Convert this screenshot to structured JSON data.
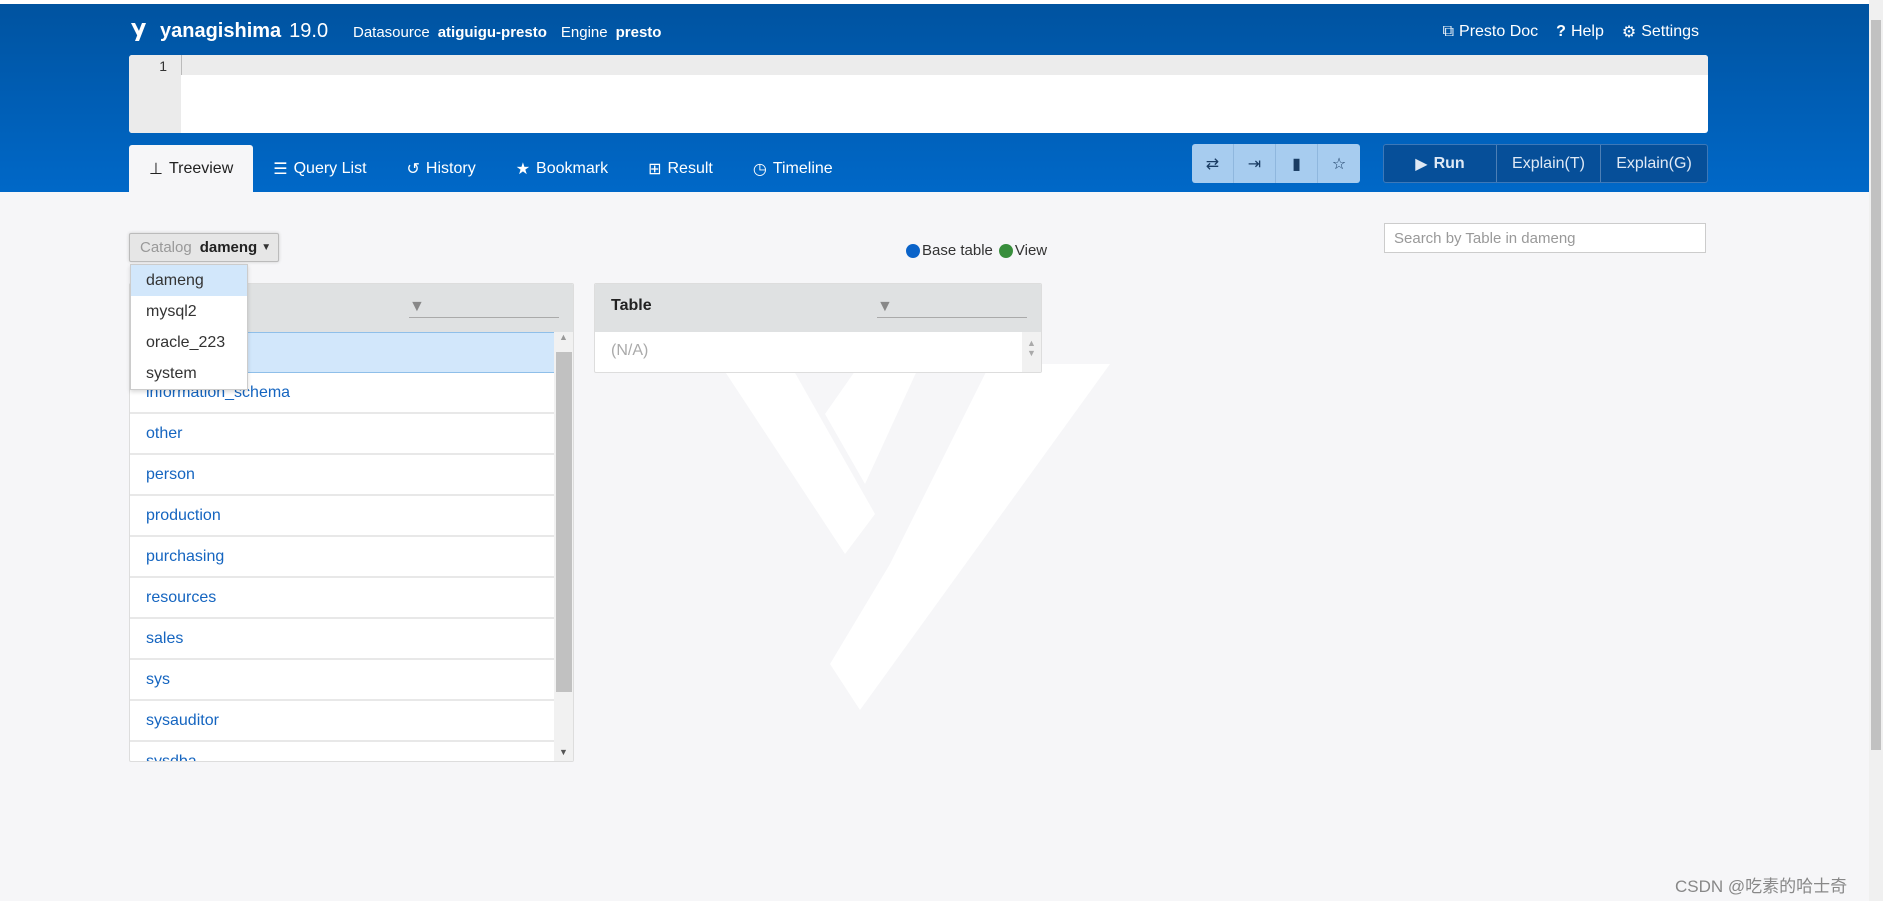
{
  "header": {
    "app_name": "yanagishima",
    "version": "19.0",
    "datasource_label": "Datasource",
    "datasource": "atiguigu-presto",
    "engine_label": "Engine",
    "engine": "presto",
    "links": [
      {
        "label": "Presto Doc",
        "icon": "external-link-icon"
      },
      {
        "label": "Help",
        "icon": "question-icon"
      },
      {
        "label": "Settings",
        "icon": "gear-icon"
      }
    ]
  },
  "editor": {
    "line_number": "1",
    "content": ""
  },
  "tabs": [
    {
      "label": "Treeview",
      "icon": "sitemap-icon",
      "active": true
    },
    {
      "label": "Query List",
      "icon": "list-icon"
    },
    {
      "label": "History",
      "icon": "history-icon"
    },
    {
      "label": "Bookmark",
      "icon": "star-icon"
    },
    {
      "label": "Result",
      "icon": "table-icon"
    },
    {
      "label": "Timeline",
      "icon": "clock-icon"
    }
  ],
  "tools": [
    "swap-icon",
    "indent-icon",
    "clipboard-icon",
    "star-outline-icon"
  ],
  "actions": {
    "run": "Run",
    "explain_t": "Explain(T)",
    "explain_g": "Explain(G)"
  },
  "catalog": {
    "label": "Catalog",
    "value": "dameng",
    "options": [
      "dameng",
      "mysql2",
      "oracle_223",
      "system"
    ]
  },
  "legend": {
    "base_table": "Base table",
    "view": "View",
    "base_color": "#0a63c9",
    "view_color": "#388e3c"
  },
  "search": {
    "placeholder": "Search by Table in dameng",
    "value": ""
  },
  "schemas": [
    "",
    "information_schema",
    "other",
    "person",
    "production",
    "purchasing",
    "resources",
    "sales",
    "sys",
    "sysauditor",
    "sysdba"
  ],
  "table_panel": {
    "header": "Table",
    "empty": "(N/A)"
  },
  "watermark": "CSDN @吃素的哈士奇"
}
